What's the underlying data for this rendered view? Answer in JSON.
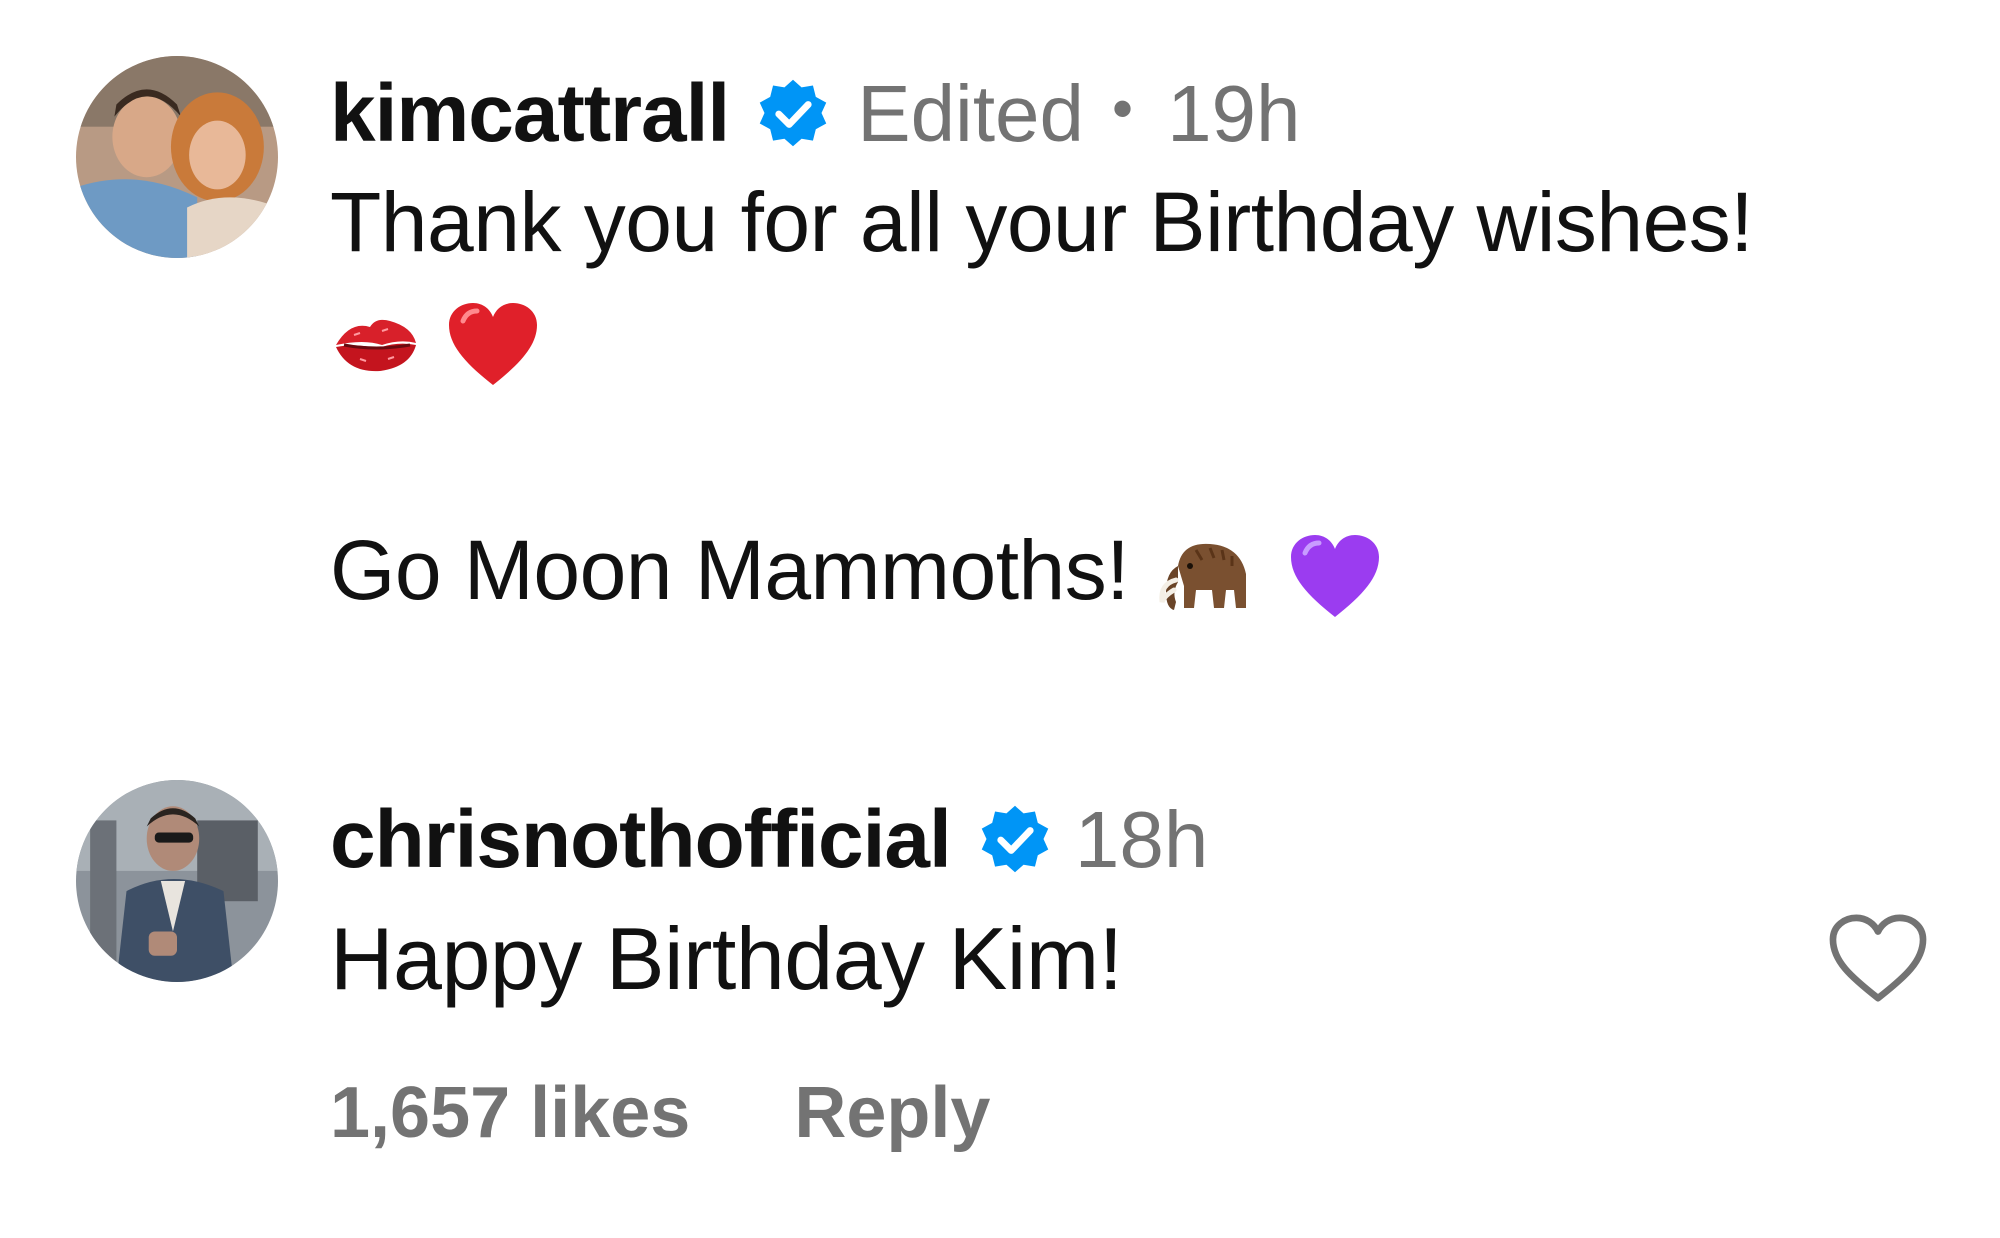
{
  "comments": [
    {
      "username": "kimcattrall",
      "verified": true,
      "edited_label": "Edited",
      "separator": "•",
      "time": "19h",
      "text_line1": "Thank you for all your Birthday wishes!",
      "text_line1_emojis": [
        "kiss-mark-icon",
        "red-heart-icon"
      ],
      "text_line2": "Go Moon Mammoths!",
      "text_line2_emojis": [
        "mammoth-icon",
        "purple-heart-icon"
      ]
    },
    {
      "username": "chrisnothofficial",
      "verified": true,
      "time": "18h",
      "text": "Happy Birthday Kim!",
      "likes": "1,657 likes",
      "reply_label": "Reply"
    }
  ],
  "colors": {
    "verified_blue": "#0095F6",
    "meta_gray": "#737373",
    "text": "#111111",
    "red_heart": "#E0202A",
    "purple_heart": "#9B3CF0"
  }
}
